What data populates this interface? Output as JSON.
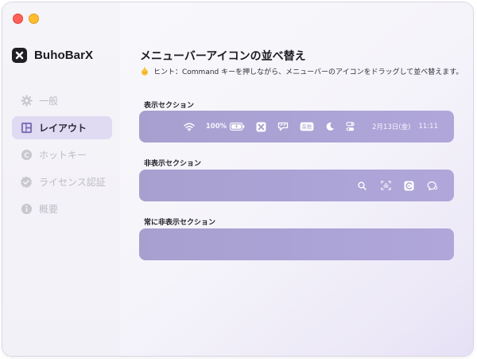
{
  "app": {
    "name": "BuhoBarX"
  },
  "sidebar": {
    "items": [
      {
        "label": "一般",
        "icon": "gear-icon",
        "active": false
      },
      {
        "label": "レイアウト",
        "icon": "layout-icon",
        "active": true
      },
      {
        "label": "ホットキー",
        "icon": "hotkey-icon",
        "active": false
      },
      {
        "label": "ライセンス認証",
        "icon": "verified-badge-icon",
        "active": false
      },
      {
        "label": "概要",
        "icon": "info-icon",
        "active": false
      }
    ]
  },
  "main": {
    "title": "メニューバーアイコンの並べ替え",
    "hint": "ヒント：Command キーを押しながら、メニューバーのアイコンをドラッグして並べ替えます。",
    "hint_icon": "hand-pointer-icon",
    "sections": [
      {
        "label": "表示セクション",
        "items": [
          {
            "type": "icon",
            "icon": "wifi-icon"
          },
          {
            "type": "text",
            "text": "100%"
          },
          {
            "type": "icon",
            "icon": "battery-icon"
          },
          {
            "type": "icon",
            "icon": "buhobarx-icon"
          },
          {
            "type": "icon",
            "icon": "bubble-icon"
          },
          {
            "type": "icon",
            "icon": "keyboard-input-icon"
          },
          {
            "type": "icon",
            "icon": "moon-icon"
          },
          {
            "type": "icon",
            "icon": "control-center-icon"
          },
          {
            "type": "text",
            "text": "2月13日(金)"
          },
          {
            "type": "text",
            "text": "11:11"
          }
        ]
      },
      {
        "label": "非表示セクション",
        "items": [
          {
            "type": "icon",
            "icon": "search-icon"
          },
          {
            "type": "icon",
            "icon": "screenshot-icon"
          },
          {
            "type": "icon",
            "icon": "app-badge-icon"
          },
          {
            "type": "icon",
            "icon": "chat-search-icon"
          }
        ]
      },
      {
        "label": "常に非表示セクション",
        "items": []
      }
    ]
  },
  "colors": {
    "accent": "#e0daf2",
    "bar": "#aaa2d4",
    "traffic_red": "#fe5f57",
    "traffic_yellow": "#febc2e"
  }
}
